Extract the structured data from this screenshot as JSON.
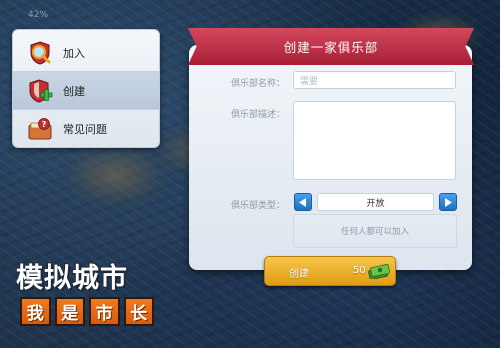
{
  "hud": {
    "percent": "42%"
  },
  "side_menu": {
    "items": [
      {
        "label": "加入",
        "icon": "magnifier-shield-icon",
        "active": false
      },
      {
        "label": "创建",
        "icon": "shield-plus-icon",
        "active": true
      },
      {
        "label": "常见问题",
        "icon": "question-book-icon",
        "active": false
      }
    ]
  },
  "panel": {
    "title": "创建一家俱乐部",
    "name_label": "俱乐部名称：",
    "name_placeholder": "需要",
    "desc_label": "俱乐部描述：",
    "type_label": "俱乐部类型：",
    "type_value": "开放",
    "type_description": "任何人都可以加入",
    "create_button": {
      "label": "创建",
      "cost": "50",
      "currency_icon": "cash-icon"
    }
  },
  "logo": {
    "line1": "模拟城市",
    "line2": [
      "我",
      "是",
      "市",
      "长"
    ]
  },
  "colors": {
    "ribbon": "#b82b42",
    "button_gold": "#eab02c",
    "arrow_blue": "#2f86d8",
    "logo_orange": "#e86a14"
  }
}
